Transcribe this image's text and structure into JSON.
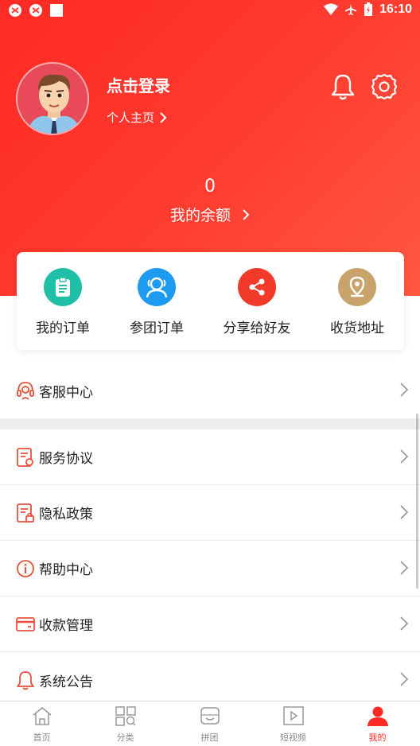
{
  "status_bar": {
    "time": "16:10"
  },
  "profile": {
    "login_text": "点击登录",
    "homepage_text": "个人主页"
  },
  "balance": {
    "amount": "0",
    "label": "我的余额"
  },
  "quick_actions": [
    {
      "label": "我的订单",
      "icon": "clipboard-icon",
      "color": "#1fbfa8"
    },
    {
      "label": "参团订单",
      "icon": "group-icon",
      "color": "#1e9af0"
    },
    {
      "label": "分享给好友",
      "icon": "share-icon",
      "color": "#f23a2a"
    },
    {
      "label": "收货地址",
      "icon": "location-pin-icon",
      "color": "#c8a46c"
    }
  ],
  "menu": [
    {
      "label": "客服中心",
      "icon": "headset-icon"
    },
    {
      "label": "服务协议",
      "icon": "agreement-doc-icon"
    },
    {
      "label": "隐私政策",
      "icon": "privacy-doc-icon"
    },
    {
      "label": "帮助中心",
      "icon": "info-icon"
    },
    {
      "label": "收款管理",
      "icon": "card-icon"
    },
    {
      "label": "系统公告",
      "icon": "bell-icon"
    }
  ],
  "tabbar": [
    {
      "label": "首页",
      "icon": "home-icon"
    },
    {
      "label": "分类",
      "icon": "category-icon"
    },
    {
      "label": "拼团",
      "icon": "group-buy-icon"
    },
    {
      "label": "短视频",
      "icon": "video-icon"
    },
    {
      "label": "我的",
      "icon": "profile-icon",
      "active": true
    }
  ],
  "colors": {
    "accent": "#ff2a24",
    "icon_red": "#e8503a"
  }
}
